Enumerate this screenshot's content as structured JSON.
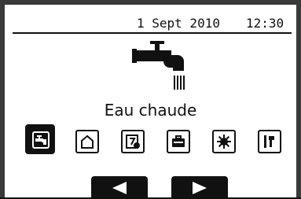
{
  "status": {
    "date": "1 Sept 2010",
    "time": "12:30"
  },
  "main": {
    "title": "Eau chaude"
  },
  "menu": {
    "items": [
      {
        "icon": "hot-water-tap-icon",
        "selected": true
      },
      {
        "icon": "house-heating-icon"
      },
      {
        "icon": "schedule-calendar-icon"
      },
      {
        "icon": "holiday-suitcase-icon"
      },
      {
        "icon": "settings-gear-icon"
      },
      {
        "icon": "service-tools-icon"
      }
    ]
  },
  "navigation": {
    "prev": "left-arrow-icon",
    "next": "right-arrow-icon"
  }
}
